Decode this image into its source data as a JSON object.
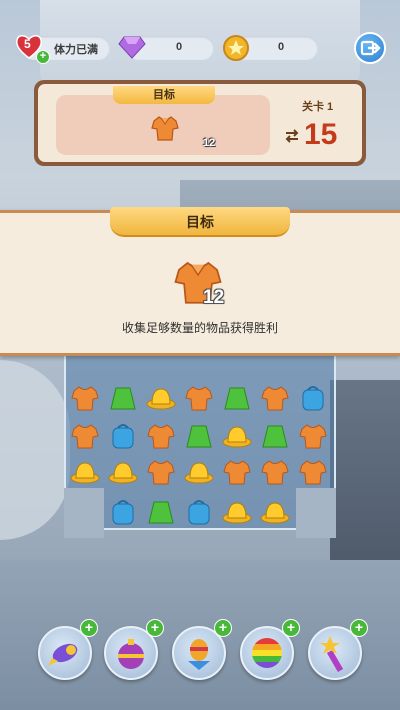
{
  "hud": {
    "lives": "5",
    "life_status": "体力已满",
    "gems": "0",
    "coins": "0"
  },
  "target_panel": {
    "tab_label": "目标",
    "item_count": "12",
    "level_label": "关卡 1",
    "moves_left": "15"
  },
  "goal_modal": {
    "title": "目标",
    "item_count": "12",
    "description": "收集足够数量的物品获得胜利"
  },
  "icons": {
    "target_item": "orange-shirt-icon",
    "boosters": [
      "rocket-icon",
      "bomb-icon",
      "spinning-top-icon",
      "rainbow-ball-icon",
      "magic-wand-icon"
    ]
  },
  "colors": {
    "accent": "#f3b840",
    "moves": "#c43b1b",
    "frame": "#8a5a3c",
    "plus": "#48b83b"
  }
}
